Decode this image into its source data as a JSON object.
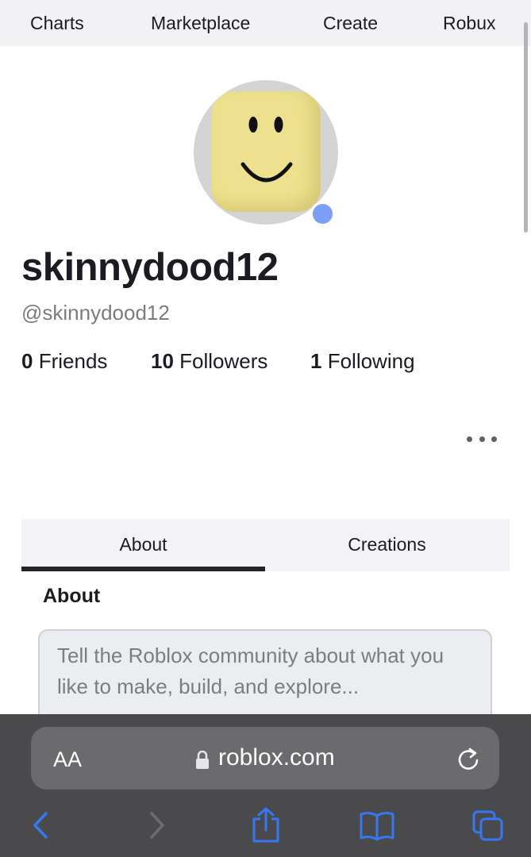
{
  "topnav": {
    "charts": "Charts",
    "marketplace": "Marketplace",
    "create": "Create",
    "robux": "Robux"
  },
  "profile": {
    "display_name": "skinnydood12",
    "username": "@skinnydood12",
    "friends_count": "0",
    "friends_label": "Friends",
    "followers_count": "10",
    "followers_label": "Followers",
    "following_count": "1",
    "following_label": "Following"
  },
  "tabs": {
    "about": "About",
    "creations": "Creations"
  },
  "about": {
    "heading": "About",
    "placeholder": "Tell the Roblox community about what you like to make, build, and explore..."
  },
  "browser": {
    "text_size": "AA",
    "url": "roblox.com"
  },
  "colors": {
    "accent": "#3478f6",
    "status": "#7b9ef7",
    "chrome": "#4a4a4c"
  }
}
